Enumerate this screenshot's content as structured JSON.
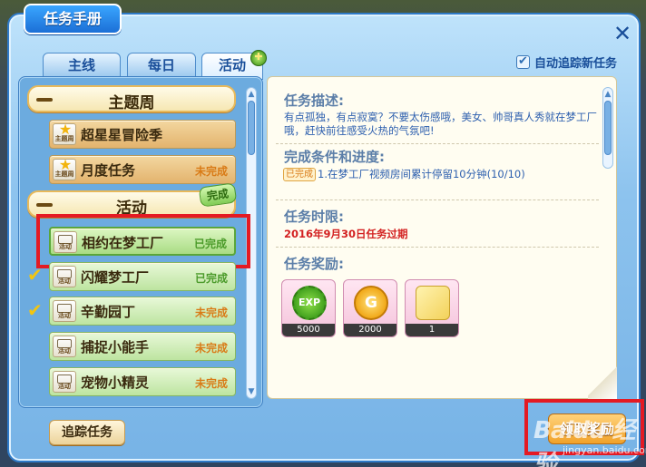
{
  "window": {
    "title": "任务手册",
    "close_label": "✕"
  },
  "tabs": [
    {
      "label": "主线",
      "active": false
    },
    {
      "label": "每日",
      "active": false
    },
    {
      "label": "活动",
      "active": true
    }
  ],
  "auto_track": {
    "label": "自动追踪新任务",
    "checked": true
  },
  "left_list": {
    "categories": [
      {
        "label": "主题周",
        "items": [
          {
            "icon": "star-theme-icon",
            "icon_text": "主题周",
            "label": "超星星冒险季",
            "status": ""
          },
          {
            "icon": "star-theme-icon",
            "icon_text": "主题周",
            "label": "月度任务",
            "status": "未完成"
          }
        ]
      },
      {
        "label": "活动",
        "badge": "完成",
        "items": [
          {
            "icon": "activity-icon",
            "icon_text": "活动",
            "label": "相约在梦工厂",
            "status": "已完成",
            "checked": false,
            "selected": true
          },
          {
            "icon": "activity-icon",
            "icon_text": "活动",
            "label": "闪耀梦工厂",
            "status": "已完成",
            "checked": true
          },
          {
            "icon": "activity-icon",
            "icon_text": "活动",
            "label": "辛勤园丁",
            "status": "未完成",
            "checked": true
          },
          {
            "icon": "activity-icon",
            "icon_text": "活动",
            "label": "捕捉小能手",
            "status": "未完成",
            "checked": false
          },
          {
            "icon": "activity-icon",
            "icon_text": "活动",
            "label": "宠物小精灵",
            "status": "未完成",
            "checked": false
          }
        ]
      }
    ]
  },
  "track_button": "追踪任务",
  "detail": {
    "desc_title": "任务描述:",
    "desc_text": "有点孤独，有点寂寞？不要太伤感哦，美女、帅哥真人秀就在梦工厂哦，赶快前往感受火热的气氛吧!",
    "cond_title": "完成条件和进度:",
    "cond_badge": "已完成",
    "cond_text": "1.在梦工厂视频房间累计停留10分钟(10/10)",
    "time_title": "任务时限:",
    "time_text": "2016年9月30日任务过期",
    "reward_title": "任务奖励:",
    "rewards": [
      {
        "icon": "exp-icon",
        "label": "EXP",
        "value": "5000"
      },
      {
        "icon": "gold-coin-icon",
        "label": "G",
        "value": "2000"
      },
      {
        "icon": "puzzle-piece-icon",
        "label": "",
        "value": "1"
      }
    ]
  },
  "claim_button": "领取奖励",
  "watermark": {
    "logo": "Baidu 经验",
    "sub": "jingyan.baidu.com"
  },
  "colors": {
    "highlight_box": "#e41a23",
    "accent_blue": "#1c6fd6",
    "done_green": "#4b9b2a",
    "pending_orange": "#d97b17"
  }
}
